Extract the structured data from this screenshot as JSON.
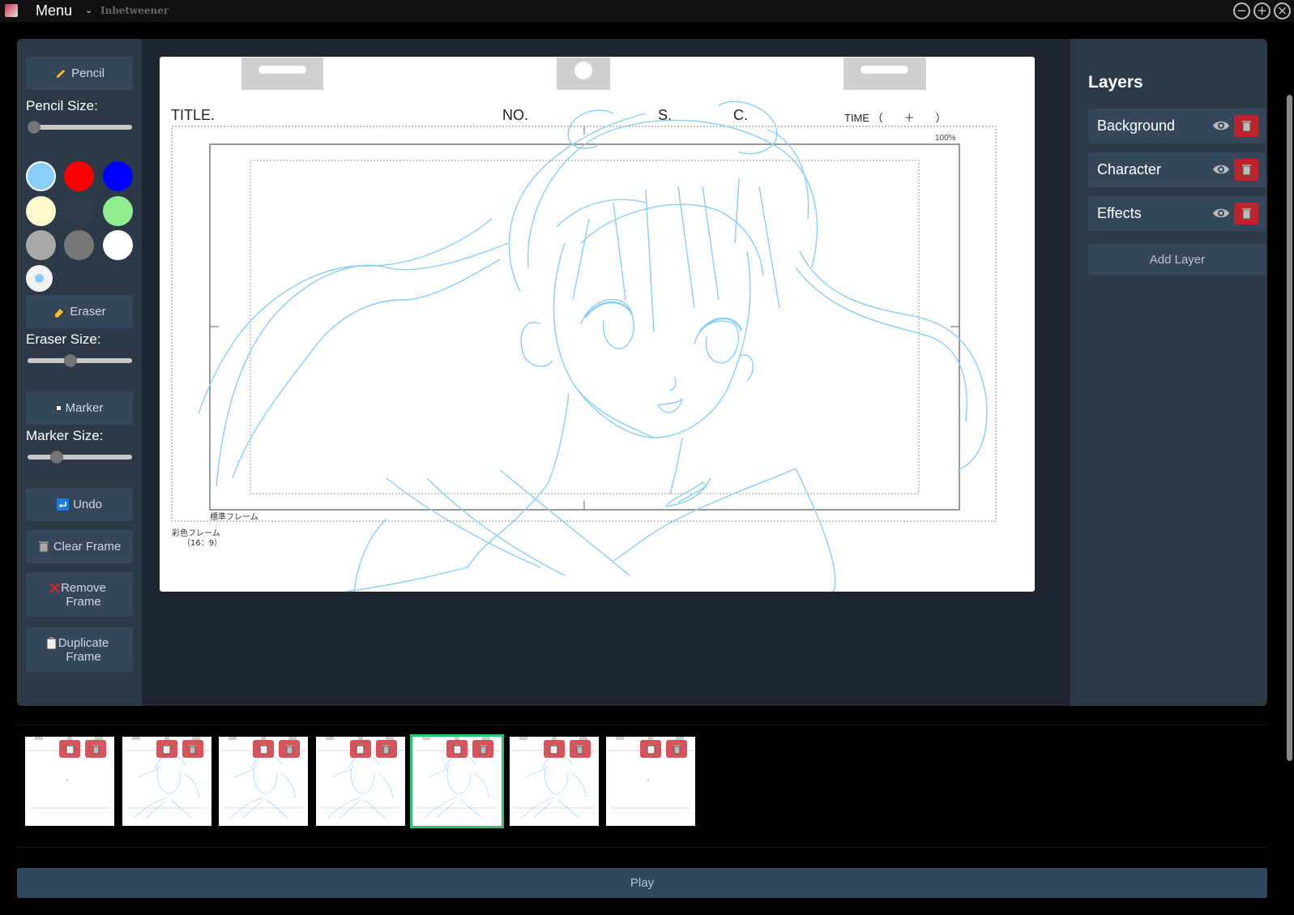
{
  "titlebar": {
    "menu_label": "Menu",
    "menu_chevron": "⌄",
    "app_name": "Inbetweener",
    "minimize": "−",
    "maximize": "+",
    "close": "×"
  },
  "toolbar": {
    "pencil_label": "Pencil",
    "pencil_size_label": "Pencil Size:",
    "pencil_size": 0,
    "eraser_label": "Eraser",
    "eraser_size_label": "Eraser Size:",
    "eraser_size": 0.4,
    "marker_label": "Marker",
    "marker_size_label": "Marker Size:",
    "marker_size": 0.25,
    "undo_label": "Undo",
    "clear_frame_label": "Clear Frame",
    "remove_frame_label": "Remove Frame",
    "duplicate_frame_label": "Duplicate Frame",
    "palette": [
      "#87cefa",
      "#ff0000",
      "#0000ff",
      "#fffacd",
      "#2f3d4a",
      "#90ee90",
      "#a9a9a9",
      "#777777",
      "#ffffff"
    ],
    "selected_color": "#87cefa"
  },
  "sheet": {
    "title_label": "TITLE.",
    "no_label": "NO.",
    "s_label": "S.",
    "c_label": "C.",
    "time_label": "TIME （　　＋　　）",
    "zoom": "100%",
    "standard_frame": "標準フレーム",
    "color_frame": "彩色フレーム",
    "color_frame_ratio": "（16：9）"
  },
  "layers": {
    "title": "Layers",
    "items": [
      {
        "name": "Background"
      },
      {
        "name": "Character"
      },
      {
        "name": "Effects"
      }
    ],
    "add_label": "Add Layer"
  },
  "timeline": {
    "frame_count": 7,
    "selected_index": 4
  },
  "play_label": "Play",
  "colors": {
    "accent_selected": "#2fc46a",
    "delete": "#c0222b",
    "sketch": "#87cefa"
  }
}
